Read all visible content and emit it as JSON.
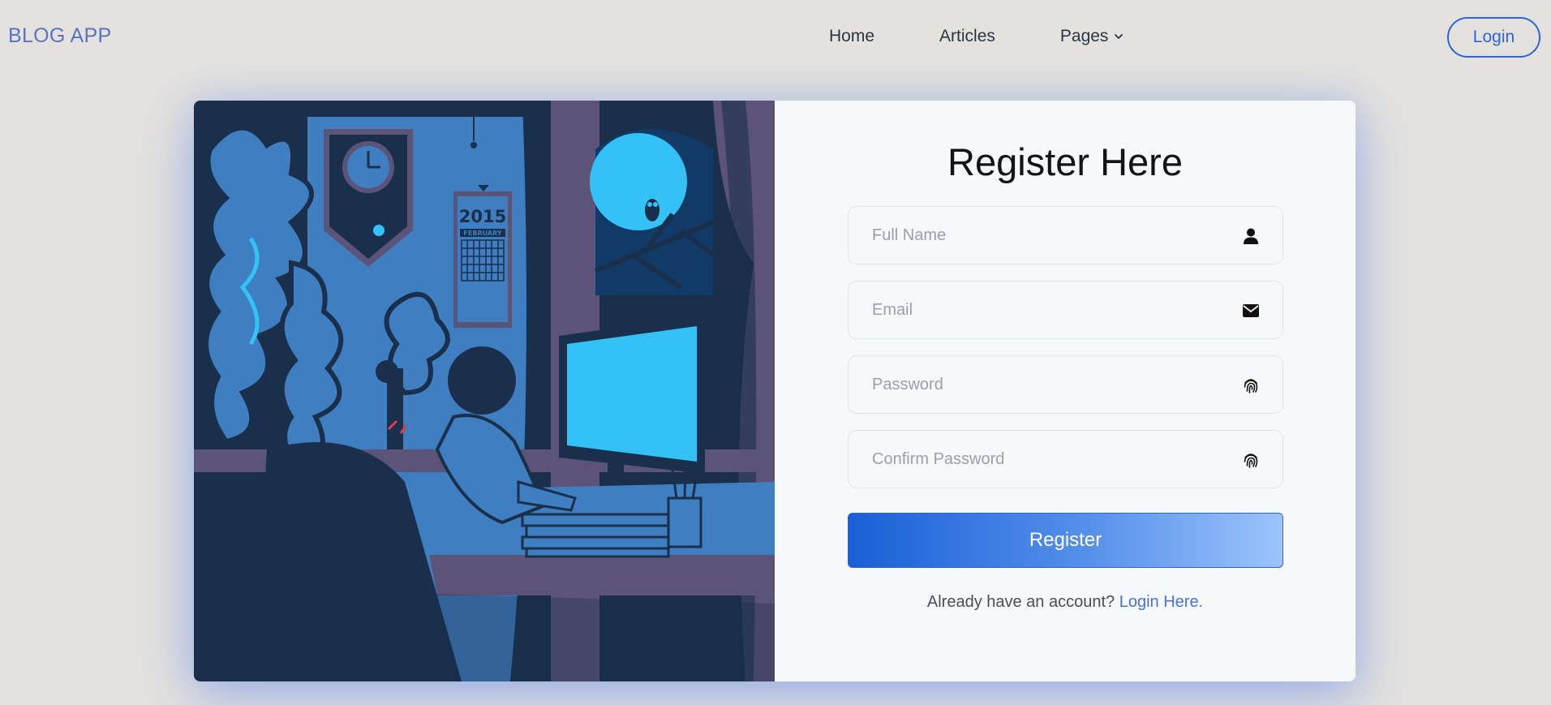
{
  "nav": {
    "brand": "BLOG APP",
    "links": [
      {
        "label": "Home"
      },
      {
        "label": "Articles"
      },
      {
        "label": "Pages"
      }
    ],
    "login_label": "Login"
  },
  "illustration": {
    "calendar_year": "2015",
    "calendar_month": "FEBRUARY"
  },
  "form": {
    "title": "Register Here",
    "fields": {
      "full_name": {
        "placeholder": "Full Name",
        "icon": "user-icon"
      },
      "email": {
        "placeholder": "Email",
        "icon": "envelope-icon"
      },
      "password": {
        "placeholder": "Password",
        "icon": "fingerprint-icon"
      },
      "confirm_password": {
        "placeholder": "Confirm Password",
        "icon": "fingerprint-icon"
      }
    },
    "submit_label": "Register",
    "footer_text": "Already have an account?",
    "footer_link": "Login Here."
  },
  "colors": {
    "page_bg": "#e4e2df",
    "brand": "#5a72c4",
    "accent": "#2f63d8",
    "link": "#4a72d8",
    "illustration_navy": "#1a2f4b",
    "illustration_blue": "#3f7ec0",
    "illustration_cyan": "#33c1f6",
    "illustration_purple": "#5c5478"
  }
}
